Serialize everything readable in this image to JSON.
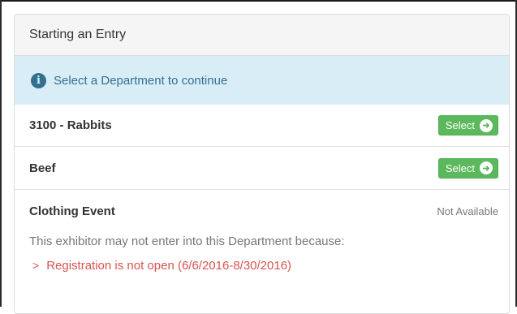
{
  "panel": {
    "title": "Starting an Entry",
    "alert_text": "Select a Department to continue"
  },
  "departments": [
    {
      "name": "3100 - Rabbits",
      "action_label": "Select"
    },
    {
      "name": "Beef",
      "action_label": "Select"
    }
  ],
  "unavailable": {
    "name": "Clothing Event",
    "status": "Not Available",
    "reason_intro": "This exhibitor may not enter into this Department because:",
    "reasons": [
      "Registration is not open (6/6/2016-8/30/2016)"
    ]
  },
  "icons": {
    "alert": "info-circle-icon",
    "select": "arrow-circle-right-icon",
    "reason": "chevron-right-icon"
  },
  "colors": {
    "alert_bg": "#d9edf7",
    "alert_text": "#31708f",
    "success": "#5cb85c",
    "danger": "#d9534f"
  }
}
